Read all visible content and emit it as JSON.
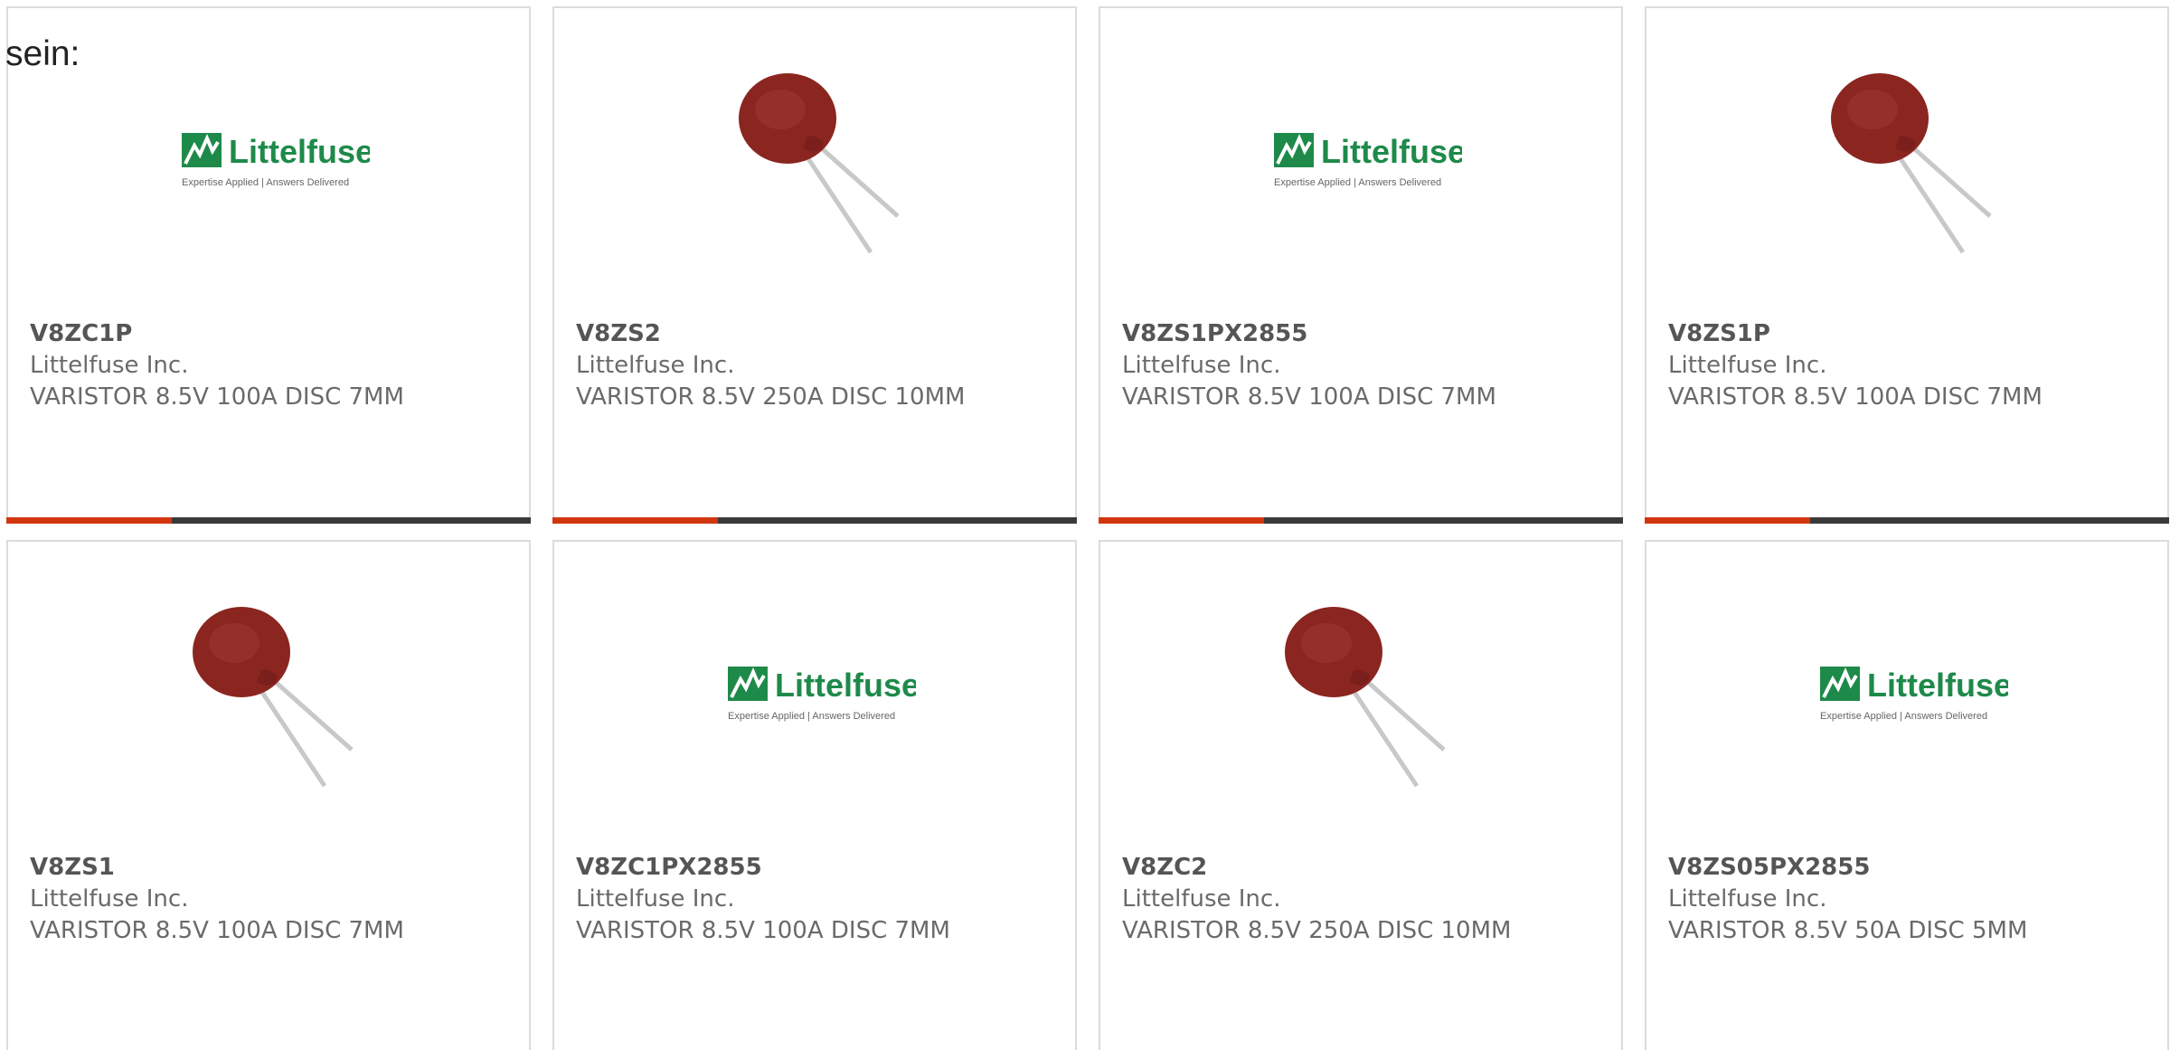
{
  "intro_text": "sein:",
  "colors": {
    "accent": "#d2360f",
    "bar": "#3a3a3a",
    "logo_green": "#1e8a4a",
    "varistor_body": "#8a2520"
  },
  "logo": {
    "brand": "Littelfuse",
    "tagline": "Expertise Applied | Answers Delivered"
  },
  "products": [
    {
      "part_number": "V8ZC1P",
      "manufacturer": "Littelfuse Inc.",
      "description": "VARISTOR 8.5V 100A DISC 7MM",
      "image": "littelfuse-logo"
    },
    {
      "part_number": "V8ZS2",
      "manufacturer": "Littelfuse Inc.",
      "description": "VARISTOR 8.5V 250A DISC 10MM",
      "image": "varistor-photo"
    },
    {
      "part_number": "V8ZS1PX2855",
      "manufacturer": "Littelfuse Inc.",
      "description": "VARISTOR 8.5V 100A DISC 7MM",
      "image": "littelfuse-logo"
    },
    {
      "part_number": "V8ZS1P",
      "manufacturer": "Littelfuse Inc.",
      "description": "VARISTOR 8.5V 100A DISC 7MM",
      "image": "varistor-photo"
    },
    {
      "part_number": "V8ZS1",
      "manufacturer": "Littelfuse Inc.",
      "description": "VARISTOR 8.5V 100A DISC 7MM",
      "image": "varistor-photo"
    },
    {
      "part_number": "V8ZC1PX2855",
      "manufacturer": "Littelfuse Inc.",
      "description": "VARISTOR 8.5V 100A DISC 7MM",
      "image": "littelfuse-logo"
    },
    {
      "part_number": "V8ZC2",
      "manufacturer": "Littelfuse Inc.",
      "description": "VARISTOR 8.5V 250A DISC 10MM",
      "image": "varistor-photo"
    },
    {
      "part_number": "V8ZS05PX2855",
      "manufacturer": "Littelfuse Inc.",
      "description": "VARISTOR 8.5V 50A DISC 5MM",
      "image": "littelfuse-logo"
    }
  ]
}
